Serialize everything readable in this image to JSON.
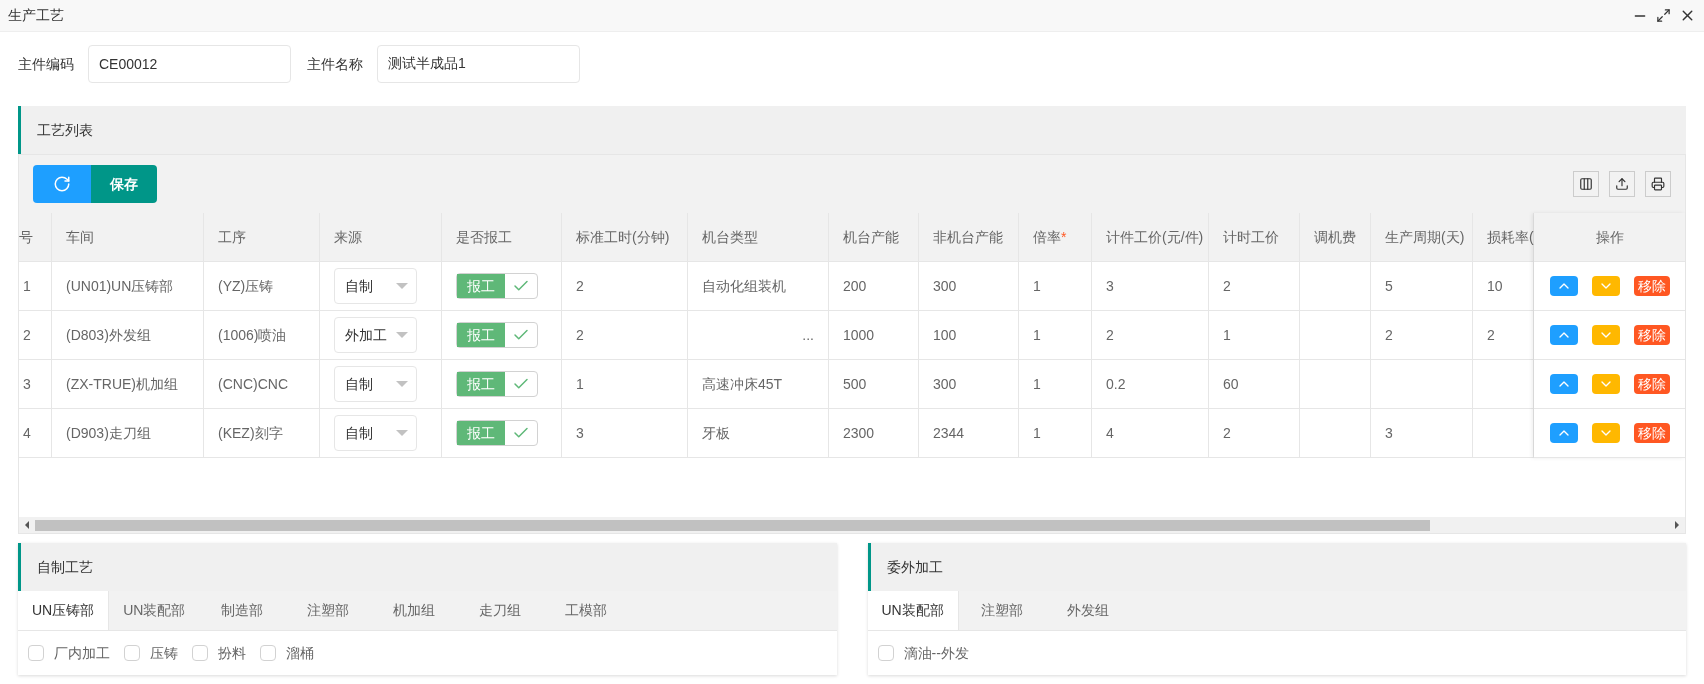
{
  "window": {
    "title": "生产工艺"
  },
  "fields": [
    {
      "label": "主件编码",
      "value": "CE00012"
    },
    {
      "label": "主件名称",
      "value": "测试半成品1"
    }
  ],
  "process_list": {
    "title": "工艺列表",
    "save_label": "保存",
    "columns": [
      {
        "label": "号",
        "required": false
      },
      {
        "label": "车间",
        "required": false
      },
      {
        "label": "工序",
        "required": false
      },
      {
        "label": "来源",
        "required": false
      },
      {
        "label": "是否报工",
        "required": false
      },
      {
        "label": "标准工时(分钟)",
        "required": false
      },
      {
        "label": "机台类型",
        "required": false
      },
      {
        "label": "机台产能",
        "required": false
      },
      {
        "label": "非机台产能",
        "required": false
      },
      {
        "label": "倍率",
        "required": true
      },
      {
        "label": "计件工价(元/件)",
        "required": false
      },
      {
        "label": "计时工价",
        "required": false
      },
      {
        "label": "调机费",
        "required": false
      },
      {
        "label": "生产周期(天)",
        "required": false
      },
      {
        "label": "损耗率(",
        "required": false
      }
    ],
    "actions_header": "操作",
    "required_mark": "*",
    "rows": [
      {
        "seq": "1",
        "workshop": "(UN01)UN压铸部",
        "process": "(YZ)压铸",
        "source": "自制",
        "report": {
          "label": "报工",
          "checked": true
        },
        "std_time": "2",
        "machine_type": "自动化组装机",
        "machine_capacity": "200",
        "non_machine_capacity": "300",
        "rate": "1",
        "piece_price": "3",
        "hourly_price": "2",
        "setup_fee": "",
        "cycle": "5",
        "loss": "10",
        "remove_label": "移除"
      },
      {
        "seq": "2",
        "workshop": "(D803)外发组",
        "process": "(1006)喷油",
        "source": "外加工",
        "report": {
          "label": "报工",
          "checked": true
        },
        "std_time": "2",
        "machine_type": "...",
        "machine_capacity": "1000",
        "non_machine_capacity": "100",
        "rate": "1",
        "piece_price": "2",
        "hourly_price": "1",
        "setup_fee": "",
        "cycle": "2",
        "loss": "2",
        "remove_label": "移除"
      },
      {
        "seq": "3",
        "workshop": "(ZX-TRUE)机加组",
        "process": "(CNC)CNC",
        "source": "自制",
        "report": {
          "label": "报工",
          "checked": true
        },
        "std_time": "1",
        "machine_type": "高速冲床45T",
        "machine_capacity": "500",
        "non_machine_capacity": "300",
        "rate": "1",
        "piece_price": "0.2",
        "hourly_price": "60",
        "setup_fee": "",
        "cycle": "",
        "loss": "",
        "remove_label": "移除"
      },
      {
        "seq": "4",
        "workshop": "(D903)走刀组",
        "process": "(KEZ)刻字",
        "source": "自制",
        "report": {
          "label": "报工",
          "checked": true
        },
        "std_time": "3",
        "machine_type": "牙板",
        "machine_capacity": "2300",
        "non_machine_capacity": "2344",
        "rate": "1",
        "piece_price": "4",
        "hourly_price": "2",
        "setup_fee": "",
        "cycle": "3",
        "loss": "",
        "remove_label": "移除"
      }
    ]
  },
  "panels": [
    {
      "title": "自制工艺",
      "tabs": [
        {
          "label": "UN压铸部",
          "selected": true
        },
        {
          "label": "UN装配部",
          "selected": false
        },
        {
          "label": "制造部",
          "selected": false
        },
        {
          "label": "注塑部",
          "selected": false
        },
        {
          "label": "机加组",
          "selected": false
        },
        {
          "label": "走刀组",
          "selected": false
        },
        {
          "label": "工模部",
          "selected": false
        }
      ],
      "options": [
        {
          "label": "厂内加工",
          "checked": false
        },
        {
          "label": "压铸",
          "checked": false
        },
        {
          "label": "扮料",
          "checked": false
        },
        {
          "label": "溜桶",
          "checked": false
        }
      ]
    },
    {
      "title": "委外加工",
      "tabs": [
        {
          "label": "UN装配部",
          "selected": true
        },
        {
          "label": "注塑部",
          "selected": false
        },
        {
          "label": "外发组",
          "selected": false
        }
      ],
      "options": [
        {
          "label": "滴油--外发",
          "checked": false
        }
      ]
    }
  ]
}
